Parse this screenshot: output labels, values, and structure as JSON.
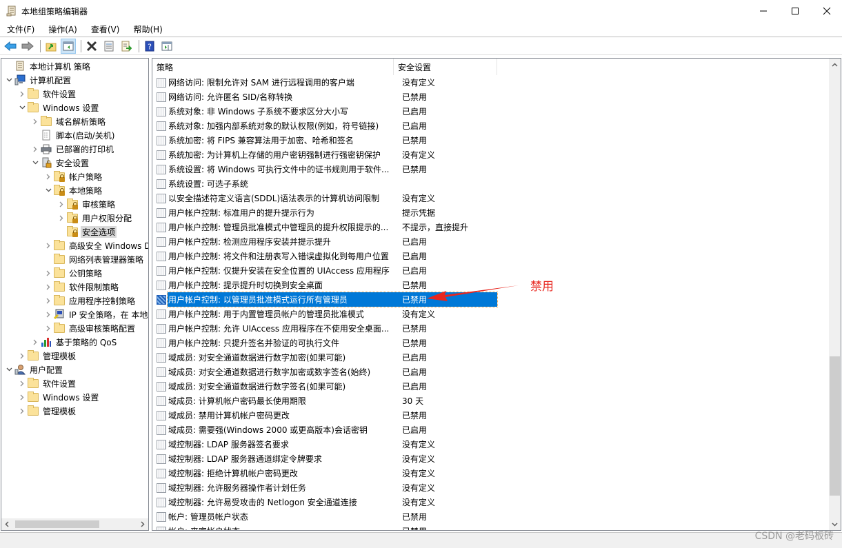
{
  "window": {
    "title": "本地组策略编辑器",
    "controls": {
      "minimize": "minimize",
      "maximize": "maximize",
      "close": "close"
    }
  },
  "menubar": {
    "items": [
      "文件(F)",
      "操作(A)",
      "查看(V)",
      "帮助(H)"
    ]
  },
  "toolbar": {
    "buttons": [
      "back-arrow",
      "forward-arrow",
      "up-folder",
      "show-hide-console-tree",
      "delete",
      "properties",
      "export-list",
      "help",
      "show-hide-action-pane"
    ]
  },
  "tree": {
    "items": [
      {
        "label": "本地计算机 策略",
        "level": 0,
        "icon": "policy-scroll",
        "expander": ""
      },
      {
        "label": "计算机配置",
        "level": 0,
        "icon": "computer",
        "expander": "expanded"
      },
      {
        "label": "软件设置",
        "level": 1,
        "icon": "folder",
        "expander": "collapsed"
      },
      {
        "label": "Windows 设置",
        "level": 1,
        "icon": "folder",
        "expander": "expanded"
      },
      {
        "label": "域名解析策略",
        "level": 2,
        "icon": "folder",
        "expander": "collapsed"
      },
      {
        "label": "脚本(启动/关机)",
        "level": 2,
        "icon": "script",
        "expander": ""
      },
      {
        "label": "已部署的打印机",
        "level": 2,
        "icon": "printer",
        "expander": "collapsed"
      },
      {
        "label": "安全设置",
        "level": 2,
        "icon": "security",
        "expander": "expanded"
      },
      {
        "label": "帐户策略",
        "level": 3,
        "icon": "lock-folder",
        "expander": "collapsed"
      },
      {
        "label": "本地策略",
        "level": 3,
        "icon": "lock-folder",
        "expander": "expanded"
      },
      {
        "label": "审核策略",
        "level": 4,
        "icon": "lock-folder",
        "expander": "collapsed"
      },
      {
        "label": "用户权限分配",
        "level": 4,
        "icon": "lock-folder",
        "expander": "collapsed"
      },
      {
        "label": "安全选项",
        "level": 4,
        "icon": "lock-folder",
        "expander": "",
        "selected": true
      },
      {
        "label": "高级安全 Windows Defender 防火墙",
        "level": 3,
        "icon": "folder",
        "expander": "collapsed"
      },
      {
        "label": "网络列表管理器策略",
        "level": 3,
        "icon": "folder",
        "expander": ""
      },
      {
        "label": "公钥策略",
        "level": 3,
        "icon": "folder",
        "expander": "collapsed"
      },
      {
        "label": "软件限制策略",
        "level": 3,
        "icon": "folder",
        "expander": "collapsed"
      },
      {
        "label": "应用程序控制策略",
        "level": 3,
        "icon": "folder",
        "expander": "collapsed"
      },
      {
        "label": "IP 安全策略，在 本地计算机",
        "level": 3,
        "icon": "ip-security",
        "expander": "collapsed"
      },
      {
        "label": "高级审核策略配置",
        "level": 3,
        "icon": "folder",
        "expander": "collapsed"
      },
      {
        "label": "基于策略的 QoS",
        "level": 2,
        "icon": "qos-chart",
        "expander": "collapsed"
      },
      {
        "label": "管理模板",
        "level": 1,
        "icon": "folder",
        "expander": "collapsed"
      },
      {
        "label": "用户配置",
        "level": 0,
        "icon": "user",
        "expander": "expanded"
      },
      {
        "label": "软件设置",
        "level": 1,
        "icon": "folder",
        "expander": "collapsed"
      },
      {
        "label": "Windows 设置",
        "level": 1,
        "icon": "folder",
        "expander": "collapsed"
      },
      {
        "label": "管理模板",
        "level": 1,
        "icon": "folder",
        "expander": "collapsed"
      }
    ]
  },
  "list": {
    "columns": {
      "policy": "策略",
      "setting": "安全设置"
    },
    "sort_indicator": "ascending",
    "rows": [
      {
        "policy": "网络访问: 限制允许对 SAM 进行远程调用的客户端",
        "setting": "没有定义"
      },
      {
        "policy": "网络访问: 允许匿名 SID/名称转换",
        "setting": "已禁用"
      },
      {
        "policy": "系统对象: 非 Windows 子系统不要求区分大小写",
        "setting": "已启用"
      },
      {
        "policy": "系统对象: 加强内部系统对象的默认权限(例如，符号链接)",
        "setting": "已启用"
      },
      {
        "policy": "系统加密: 将 FIPS 兼容算法用于加密、哈希和签名",
        "setting": "已禁用"
      },
      {
        "policy": "系统加密: 为计算机上存储的用户密钥强制进行强密钥保护",
        "setting": "没有定义"
      },
      {
        "policy": "系统设置: 将 Windows 可执行文件中的证书规则用于软件...",
        "setting": "已禁用"
      },
      {
        "policy": "系统设置: 可选子系统",
        "setting": ""
      },
      {
        "policy": "以安全描述符定义语言(SDDL)语法表示的计算机访问限制",
        "setting": "没有定义"
      },
      {
        "policy": "用户帐户控制: 标准用户的提升提示行为",
        "setting": "提示凭据"
      },
      {
        "policy": "用户帐户控制: 管理员批准模式中管理员的提升权限提示的...",
        "setting": "不提示，直接提升"
      },
      {
        "policy": "用户帐户控制: 检测应用程序安装并提示提升",
        "setting": "已启用"
      },
      {
        "policy": "用户帐户控制: 将文件和注册表写入错误虚拟化到每用户位置",
        "setting": "已启用"
      },
      {
        "policy": "用户帐户控制: 仅提升安装在安全位置的 UIAccess 应用程序",
        "setting": "已启用"
      },
      {
        "policy": "用户帐户控制: 提示提升时切换到安全桌面",
        "setting": "已禁用"
      },
      {
        "policy": "用户帐户控制: 以管理员批准模式运行所有管理员",
        "setting": "已禁用",
        "selected": true
      },
      {
        "policy": "用户帐户控制: 用于内置管理员帐户的管理员批准模式",
        "setting": "没有定义"
      },
      {
        "policy": "用户帐户控制: 允许 UIAccess 应用程序在不使用安全桌面...",
        "setting": "已禁用"
      },
      {
        "policy": "用户帐户控制: 只提升签名并验证的可执行文件",
        "setting": "已禁用"
      },
      {
        "policy": "域成员: 对安全通道数据进行数字加密(如果可能)",
        "setting": "已启用"
      },
      {
        "policy": "域成员: 对安全通道数据进行数字加密或数字签名(始终)",
        "setting": "已启用"
      },
      {
        "policy": "域成员: 对安全通道数据进行数字签名(如果可能)",
        "setting": "已启用"
      },
      {
        "policy": "域成员: 计算机帐户密码最长使用期限",
        "setting": "30 天"
      },
      {
        "policy": "域成员: 禁用计算机帐户密码更改",
        "setting": "已禁用"
      },
      {
        "policy": "域成员: 需要强(Windows 2000 或更高版本)会话密钥",
        "setting": "已启用"
      },
      {
        "policy": "域控制器: LDAP 服务器签名要求",
        "setting": "没有定义"
      },
      {
        "policy": "域控制器: LDAP 服务器通道绑定令牌要求",
        "setting": "没有定义"
      },
      {
        "policy": "域控制器: 拒绝计算机帐户密码更改",
        "setting": "没有定义"
      },
      {
        "policy": "域控制器: 允许服务器操作者计划任务",
        "setting": "没有定义"
      },
      {
        "policy": "域控制器: 允许易受攻击的 Netlogon 安全通道连接",
        "setting": "没有定义"
      },
      {
        "policy": "帐户: 管理员帐户状态",
        "setting": "已禁用"
      },
      {
        "policy": "帐户: 来宾帐户状态",
        "setting": "已禁用"
      }
    ]
  },
  "annotation": {
    "text": "禁用",
    "color": "#e8261e"
  },
  "watermark": "CSDN @老码板砖",
  "colors": {
    "selection": "#0078d7",
    "tree_selection": "#d9d9d9"
  }
}
